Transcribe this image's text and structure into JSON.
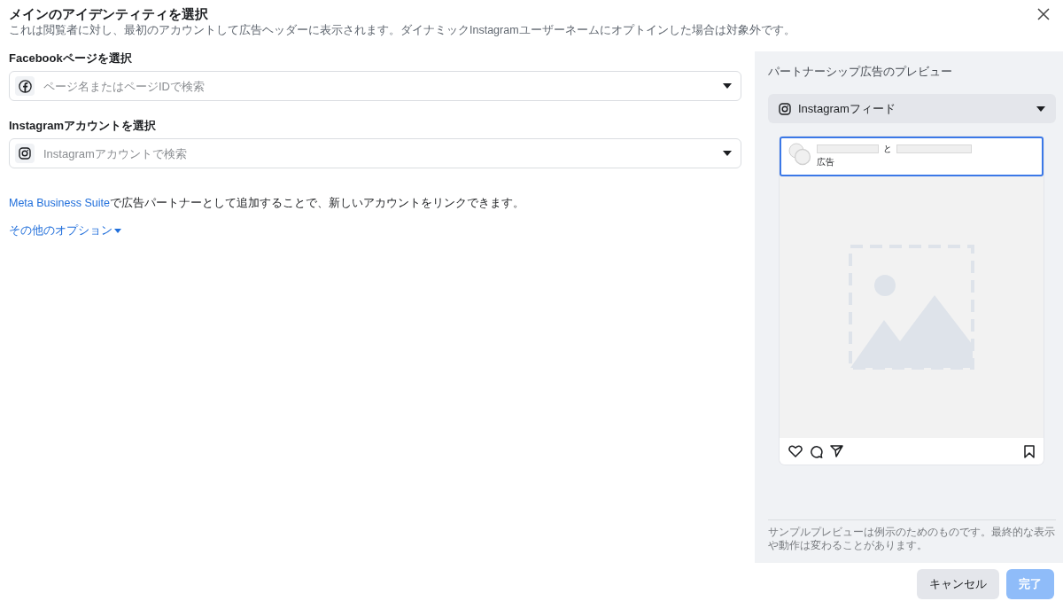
{
  "dialog": {
    "title": "メインのアイデンティティを選択",
    "subtitle": "これは閲覧者に対し、最初のアカウントして広告ヘッダーに表示されます。ダイナミックInstagramユーザーネームにオプトインした場合は対象外です。"
  },
  "fields": [
    {
      "kind": "facebook",
      "label": "Facebookページを選択",
      "placeholder": "ページ名またはページIDで検索"
    },
    {
      "kind": "instagram",
      "label": "Instagramアカウントを選択",
      "placeholder": "Instagramアカウントで検索"
    }
  ],
  "link_note": {
    "link": "Meta Business Suite",
    "text": "で広告パートナーとして追加することで、新しいアカウントをリンクできます。"
  },
  "more_options": {
    "label": "その他のオプション",
    "expanded": false
  },
  "preview": {
    "title": "パートナーシップ広告のプレビュー",
    "placement": "Instagramフィード",
    "post": {
      "joiner": "と",
      "sponsored": "広告",
      "selected": true
    },
    "disclaimer": "サンプルプレビューは例示のためのものです。最終的な表示や動作は変わることがあります。"
  },
  "buttons": [
    {
      "kind": "secondary",
      "label": "キャンセル",
      "disabled": false
    },
    {
      "kind": "primary",
      "label": "完了",
      "disabled": true
    }
  ]
}
